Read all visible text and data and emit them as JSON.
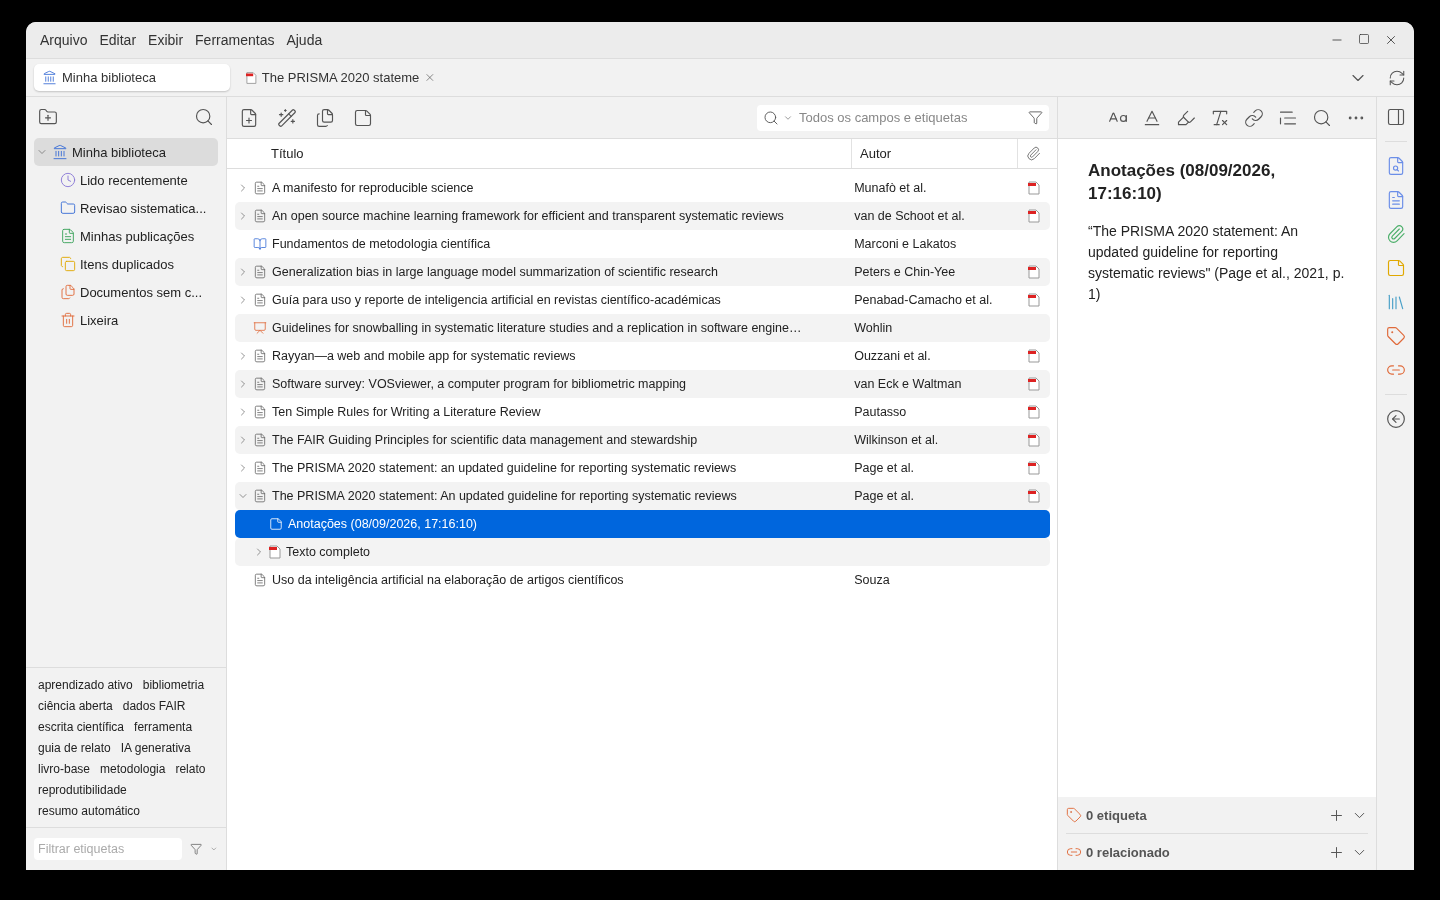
{
  "menu": [
    "Arquivo",
    "Editar",
    "Exibir",
    "Ferramentas",
    "Ajuda"
  ],
  "tabs": [
    {
      "label": "Minha biblioteca",
      "kind": "library",
      "selected": true
    },
    {
      "label": "The PRISMA 2020 stateme",
      "kind": "pdf",
      "selected": false
    }
  ],
  "collections": {
    "label": "Minha biblioteca",
    "kind": "library",
    "selected": true,
    "expanded": true,
    "children": [
      {
        "label": "Lido recentemente",
        "kind": "recent",
        "selected": false
      },
      {
        "label": "Revisao sistematica...",
        "kind": "folder",
        "selected": false
      },
      {
        "label": "Minhas publicações",
        "kind": "publications",
        "selected": false
      },
      {
        "label": "Itens duplicados",
        "kind": "duplicates",
        "selected": false
      },
      {
        "label": "Documentos sem c...",
        "kind": "unfiled",
        "selected": false
      },
      {
        "label": "Lixeira",
        "kind": "trash",
        "selected": false
      }
    ]
  },
  "tags": [
    "aprendizado ativo",
    "bibliometria",
    "ciência aberta",
    "dados FAIR",
    "escrita científica",
    "ferramenta",
    "guia de relato",
    "IA generativa",
    "livro-base",
    "metodologia",
    "relato",
    "reprodutibilidade",
    "resumo automático"
  ],
  "tag_filter": {
    "placeholder": "Filtrar etiquetas"
  },
  "search": {
    "placeholder": "Todos os campos e etiquetas"
  },
  "table": {
    "columns": [
      "Título",
      "Autor"
    ],
    "rows": [
      {
        "title": "A manifesto for reproducible science",
        "author": "Munafò et al.",
        "kind": "document",
        "expanded": false,
        "pdf": true,
        "selected": false
      },
      {
        "title": "An open source machine learning framework for efficient and transparent systematic reviews",
        "author": "van de Schoot et al.",
        "kind": "document",
        "expanded": false,
        "pdf": true,
        "selected": false
      },
      {
        "title": "Fundamentos de metodologia científica",
        "author": "Marconi e Lakatos",
        "kind": "book",
        "pdf": false,
        "selected": false
      },
      {
        "title": "Generalization bias in large language model summarization of scientific research",
        "author": "Peters e Chin-Yee",
        "kind": "document",
        "expanded": false,
        "pdf": true,
        "selected": false
      },
      {
        "title": "Guía para uso y reporte de inteligencia artificial en revistas científico-académicas",
        "author": "Penabad-Camacho et al.",
        "kind": "document",
        "expanded": false,
        "pdf": true,
        "selected": false
      },
      {
        "title": "Guidelines for snowballing in systematic literature studies and a replication in software engine…",
        "author": "Wohlin",
        "kind": "presentation",
        "pdf": false,
        "selected": false
      },
      {
        "title": "Rayyan—a web and mobile app for systematic reviews",
        "author": "Ouzzani et al.",
        "kind": "document",
        "expanded": false,
        "pdf": true,
        "selected": false
      },
      {
        "title": "Software survey: VOSviewer, a computer program for bibliometric mapping",
        "author": "van Eck e Waltman",
        "kind": "document",
        "expanded": false,
        "pdf": true,
        "selected": false
      },
      {
        "title": "Ten Simple Rules for Writing a Literature Review",
        "author": "Pautasso",
        "kind": "document",
        "expanded": false,
        "pdf": true,
        "selected": false
      },
      {
        "title": "The FAIR Guiding Principles for scientific data management and stewardship",
        "author": "Wilkinson et al.",
        "kind": "document",
        "expanded": false,
        "pdf": true,
        "selected": false
      },
      {
        "title": "The PRISMA 2020 statement: an updated guideline for reporting systematic reviews",
        "author": "Page et al.",
        "kind": "document",
        "expanded": false,
        "pdf": true,
        "selected": false
      },
      {
        "title": "The PRISMA 2020 statement: An updated guideline for reporting systematic reviews",
        "author": "Page et al.",
        "kind": "document",
        "expanded": true,
        "pdf": true,
        "selected": false,
        "children": [
          {
            "title": "Anotações (08/09/2026, 17:16:10)",
            "kind": "note",
            "pdf": false,
            "selected": true
          },
          {
            "title": "Texto completo",
            "kind": "pdf",
            "expanded": false,
            "pdf": false,
            "selected": false
          }
        ]
      },
      {
        "title": "Uso da inteligência artificial na elaboração de artigos científicos",
        "author": "Souza",
        "kind": "document",
        "pdf": false,
        "selected": false
      }
    ]
  },
  "note": {
    "heading": "Anotações (08/09/2026, 17:16:10)",
    "body": "“The PRISMA 2020 statement: An updated guideline for reporting systematic reviews\" (Page et al., 2021, p. 1)"
  },
  "sections": [
    {
      "label": "0 etiqueta",
      "kind": "tags"
    },
    {
      "label": "0 relacionado",
      "kind": "related"
    }
  ]
}
